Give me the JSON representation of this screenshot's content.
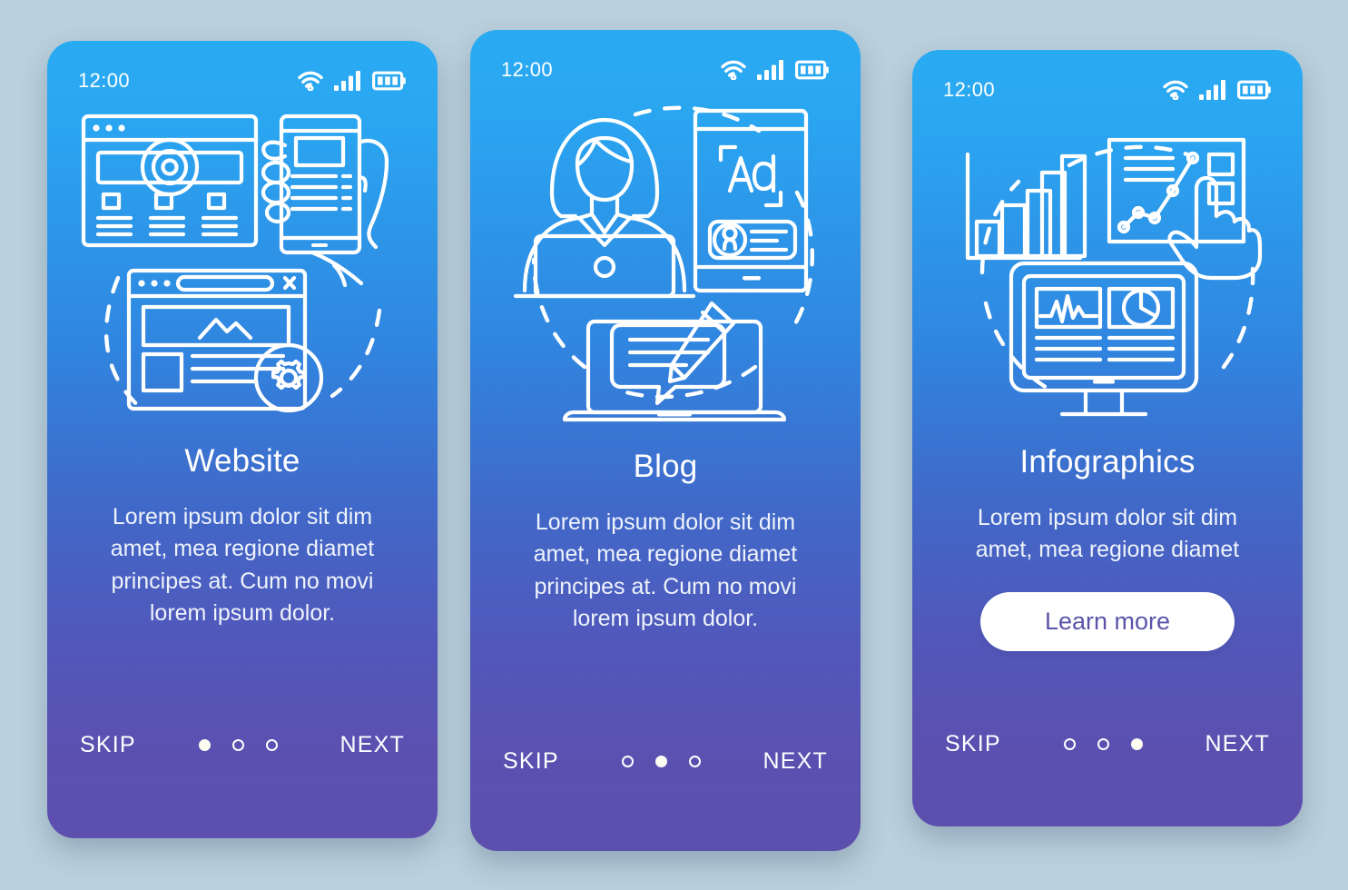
{
  "page": {
    "background_color": "#bad0dc",
    "gradient_top": "#29abf2",
    "gradient_bottom": "#5b50b0"
  },
  "statusbar": {
    "time": "12:00",
    "icons": [
      "wifi-icon",
      "cellular-signal-icon",
      "battery-icon"
    ]
  },
  "nav": {
    "skip_label": "SKIP",
    "next_label": "NEXT",
    "dot_count": 3
  },
  "screens": [
    {
      "id": "website",
      "title": "Website",
      "description": "Lorem ipsum dolor sit dim amet, mea regione diamet principes at. Cum no movi lorem ipsum dolor.",
      "illustration": "website-illustration",
      "active_dot": 1,
      "cta": null
    },
    {
      "id": "blog",
      "title": "Blog",
      "description": "Lorem ipsum dolor sit dim amet, mea regione diamet principes at. Cum no movi lorem ipsum dolor.",
      "illustration": "blog-illustration",
      "illustration_text": "Ad",
      "active_dot": 2,
      "cta": null
    },
    {
      "id": "infographics",
      "title": "Infographics",
      "description": "Lorem ipsum dolor sit dim amet, mea regione diamet",
      "illustration": "infographics-illustration",
      "active_dot": 3,
      "cta": {
        "label": "Learn more",
        "background_color": "#ffffff",
        "text_color": "#5b54a8"
      }
    }
  ]
}
